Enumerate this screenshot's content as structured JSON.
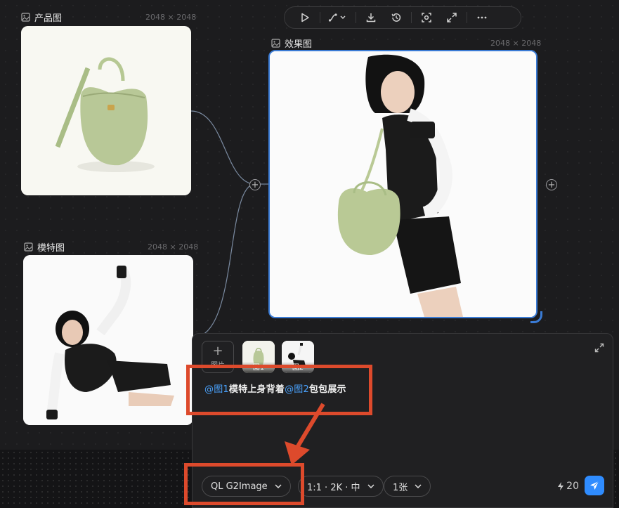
{
  "toolbar": {
    "buttons": [
      "play-icon",
      "connector-icon",
      "download-icon",
      "history-icon",
      "focus-icon",
      "fullscreen-icon",
      "more-icon"
    ]
  },
  "nodes": {
    "product": {
      "title": "产品图",
      "size": "2048 × 2048"
    },
    "model": {
      "title": "模特图",
      "size": "2048 × 2048"
    },
    "result": {
      "title": "效果图",
      "size": "2048 × 2048"
    }
  },
  "panel": {
    "add_image_label": "图片",
    "refs": [
      {
        "label": "图1"
      },
      {
        "label": "图2"
      }
    ],
    "prompt": {
      "ref1": "@图1",
      "text1": "模特上身背着",
      "ref2": "@图2",
      "text2": "包包展示"
    },
    "model_select": "QL G2Image",
    "ratio_select": "1:1 · 2K · 中",
    "count_select": "1张",
    "credits": "20"
  },
  "colors": {
    "accent": "#2f8cff",
    "annotation": "#dd4a2c",
    "selection": "#3a7bd5"
  }
}
